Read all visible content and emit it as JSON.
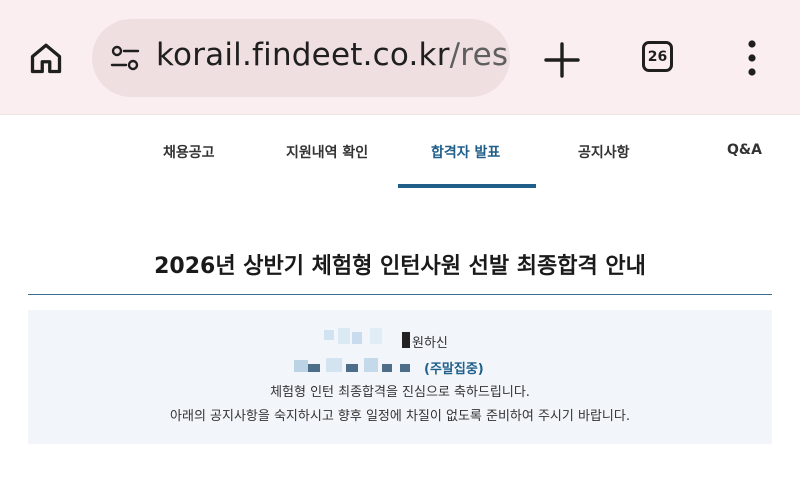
{
  "browser": {
    "url_host": "korail.findeet.co.kr",
    "url_path": "/resul",
    "tab_count": "26"
  },
  "nav": {
    "items": [
      "채용공고",
      "지원내역 확인",
      "합격자 발표",
      "공지사항",
      "Q&A"
    ],
    "active_index": 2
  },
  "page": {
    "title": "2026년 상반기 체험형 인턴사원 선발 최종합격 안내"
  },
  "notice": {
    "line1_suffix": "원하신",
    "line2_highlight": "(주말집중)",
    "line3": "체험형 인턴 최종합격을 진심으로 축하드립니다.",
    "line4": "아래의 공지사항을 숙지하시고 향후 일정에 차질이 없도록 준비하여 주시기 바랍니다."
  },
  "colors": {
    "browser_bg": "#fbeef0",
    "url_pill": "#efdfe1",
    "accent": "#1f5f8a",
    "notice_bg": "#f2f6fa"
  }
}
